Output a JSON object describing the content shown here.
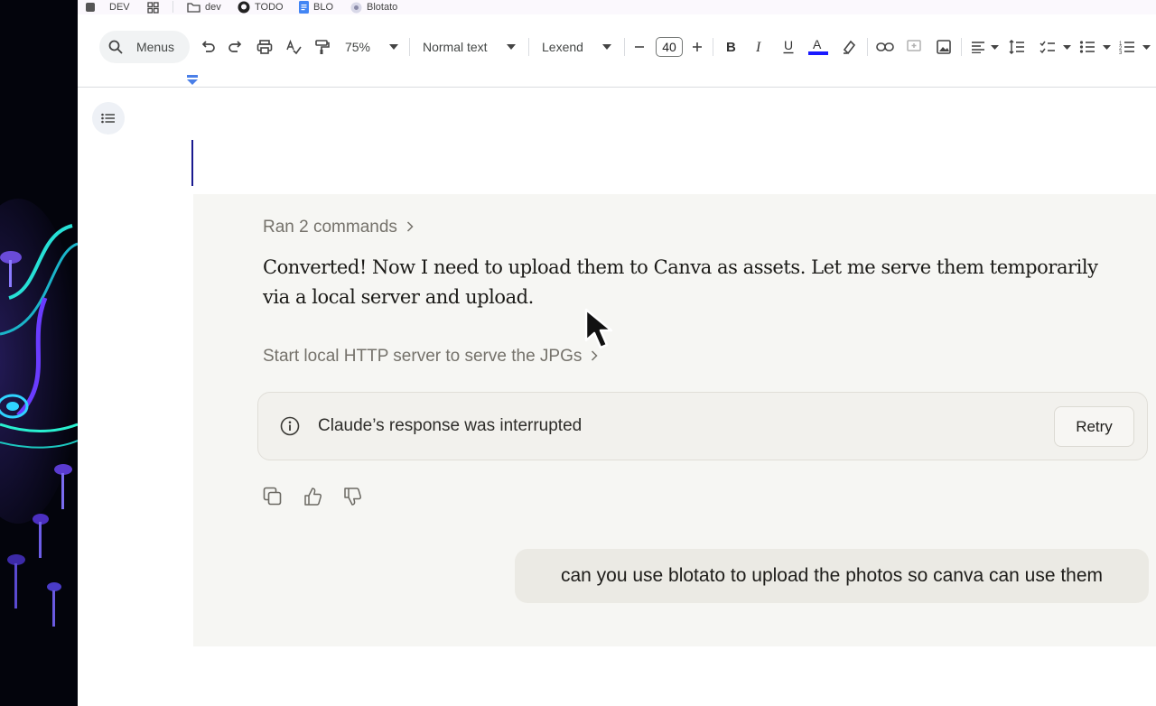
{
  "bookmarks": [
    {
      "label": "DEV",
      "icon": "square-icon"
    },
    {
      "label": "",
      "icon": "grid-icon"
    },
    {
      "label": "dev",
      "icon": "folder-icon"
    },
    {
      "label": "TODO",
      "icon": "github-icon"
    },
    {
      "label": "BLO",
      "icon": "doc-icon"
    },
    {
      "label": "Blotato",
      "icon": "blotato-icon"
    }
  ],
  "toolbar": {
    "menus_label": "Menus",
    "zoom": "75%",
    "style": "Normal text",
    "font": "Lexend",
    "font_size": "40"
  },
  "chat": {
    "ran_commands": "Ran 2 commands",
    "assistant_message": "Converted! Now I need to upload them to Canva as assets. Let me serve them temporarily via a local server and upload.",
    "tool_step": "Start local HTTP server to serve the JPGs",
    "interrupted_text": "Claude’s response was interrupted",
    "retry_label": "Retry",
    "user_message": "can you use blotato to upload the photos so canva can use them"
  },
  "colors": {
    "text_color_underline": "#1a1aff",
    "caret": "#1a1a8f",
    "chat_bg": "#f6f6f3"
  }
}
